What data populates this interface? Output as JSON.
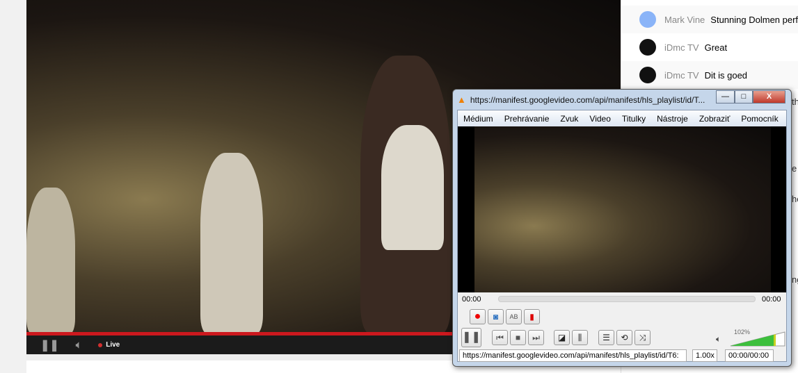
{
  "player": {
    "live_label": "Live",
    "colors": {
      "progress": "#cc181e",
      "live_dot": "#d32f2f"
    }
  },
  "chat": {
    "messages": [
      {
        "author": "Mark Vine",
        "text": "Stunning Dolmen perf"
      },
      {
        "author": "iDmc TV",
        "text": "Great"
      },
      {
        "author": "iDmc TV",
        "text": "Dit is goed"
      }
    ],
    "peek": [
      "th",
      "e",
      "he",
      "ng"
    ]
  },
  "vlc": {
    "title": "https://manifest.googlevideo.com/api/manifest/hls_playlist/id/T...",
    "window_buttons": {
      "minimize": "—",
      "maximize": "□",
      "close": "X"
    },
    "menu": [
      "Médium",
      "Prehrávanie",
      "Zvuk",
      "Video",
      "Titulky",
      "Nástroje",
      "Zobraziť",
      "Pomocník"
    ],
    "time_elapsed": "00:00",
    "time_total": "00:00",
    "volume": "102%",
    "volume_fraction": 1.02,
    "status_url": "https://manifest.googlevideo.com/api/manifest/hls_playlist/id/T6:",
    "speed": "1.00x",
    "status_time": "00:00/00:00"
  }
}
